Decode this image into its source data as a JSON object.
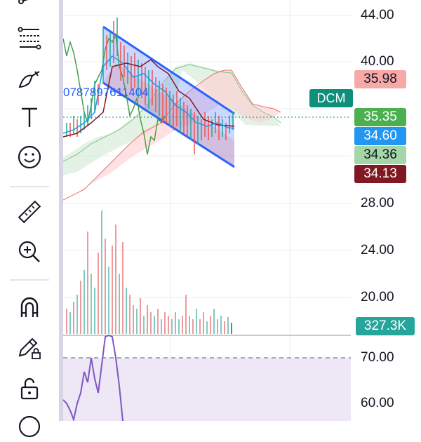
{
  "toolbar": {
    "tools": [
      {
        "name": "trend-line-tool",
        "icon": "line-tool-icon"
      },
      {
        "name": "fib-tool",
        "icon": "fib-icon"
      },
      {
        "name": "brush-tool",
        "icon": "brush-icon"
      },
      {
        "name": "text-tool",
        "icon": "text-icon"
      },
      {
        "name": "emoji-tool",
        "icon": "emoji-icon"
      },
      {
        "name": "ruler-tool",
        "icon": "ruler-icon"
      },
      {
        "name": "zoom-in-tool",
        "icon": "zoom-in-icon"
      },
      {
        "name": "magnet-tool",
        "icon": "magnet-icon"
      },
      {
        "name": "lock-drawing-tool",
        "icon": "pencil-lock-icon"
      },
      {
        "name": "lock-all-tool",
        "icon": "unlock-icon"
      }
    ]
  },
  "chart": {
    "symbol_tag": "DCM",
    "overlay_id_text": "0787897611404",
    "price_axis_ticks": [
      "44.00",
      "40.00",
      "28.00",
      "24.00",
      "20.00"
    ],
    "rsi_axis_ticks": [
      "70.00",
      "60.00"
    ],
    "price_tags": [
      {
        "label": "35.98",
        "bg": "#f7a9a7",
        "fg": "#131722",
        "name": "cloud-span-b-tag"
      },
      {
        "label": "35.35",
        "bg": "#4caf50",
        "fg": "#ffffff",
        "name": "last-price-tag"
      },
      {
        "label": "34.60",
        "bg": "#2196f3",
        "fg": "#ffffff",
        "name": "conversion-line-tag"
      },
      {
        "label": "34.36",
        "bg": "#a5d6a7",
        "fg": "#131722",
        "name": "cloud-span-a-tag"
      },
      {
        "label": "34.13",
        "bg": "#801922",
        "fg": "#ffffff",
        "name": "base-line-tag"
      }
    ],
    "volume_tag": {
      "label": "327.3K",
      "bg": "#26a69a",
      "fg": "#ffffff"
    },
    "colors": {
      "up": "#26a69a",
      "down": "#ef5350",
      "channel": "#2962ff",
      "rsi": "#7e57c2",
      "grid": "#eceef3"
    }
  }
}
